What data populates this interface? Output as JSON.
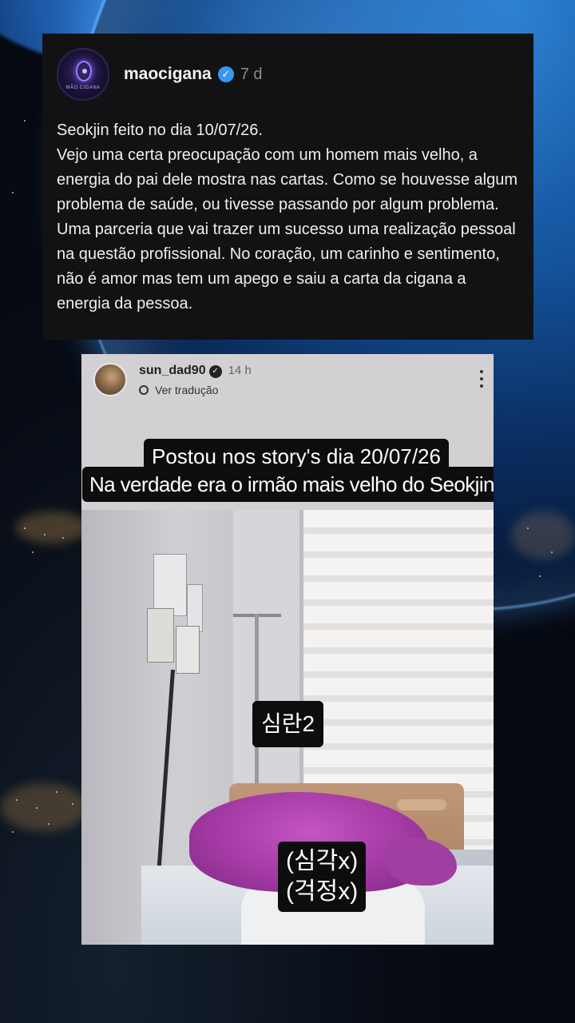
{
  "caption": {
    "username": "maocigana",
    "time": "7 d",
    "avatar_label": "MÃO CIGANA",
    "text": "Seokjin feito no dia 10/07/26.\nVejo uma certa preocupação com um homem mais velho, a energia do pai dele mostra nas cartas. Como se houvesse algum problema de saúde, ou tivesse passando por algum problema.  Uma parceria que vai trazer um sucesso uma realização pessoal na questão profissional. No coração, um carinho e sentimento, não é amor mas tem um apego e saiu a carta da cigana a energia da pessoa."
  },
  "story": {
    "username": "sun_dad90",
    "time": "14 h",
    "translate_label": "Ver tradução",
    "sticker_line1": "Postou nos story's dia 20/07/26",
    "sticker_line2": "Na verdade era o irmão mais velho do Seokjin.",
    "korean_label_1": "심란2",
    "korean_label_2a": "(심각x)",
    "korean_label_2b": "(걱정x)"
  },
  "colors": {
    "caption_bg": "#121214",
    "verified_blue": "#3897f0",
    "blanket_magenta": "#b045b0",
    "sticker_bg": "#0d0d0d"
  },
  "icons": [
    "verified-badge-icon",
    "translate-icon",
    "more-options-icon"
  ]
}
